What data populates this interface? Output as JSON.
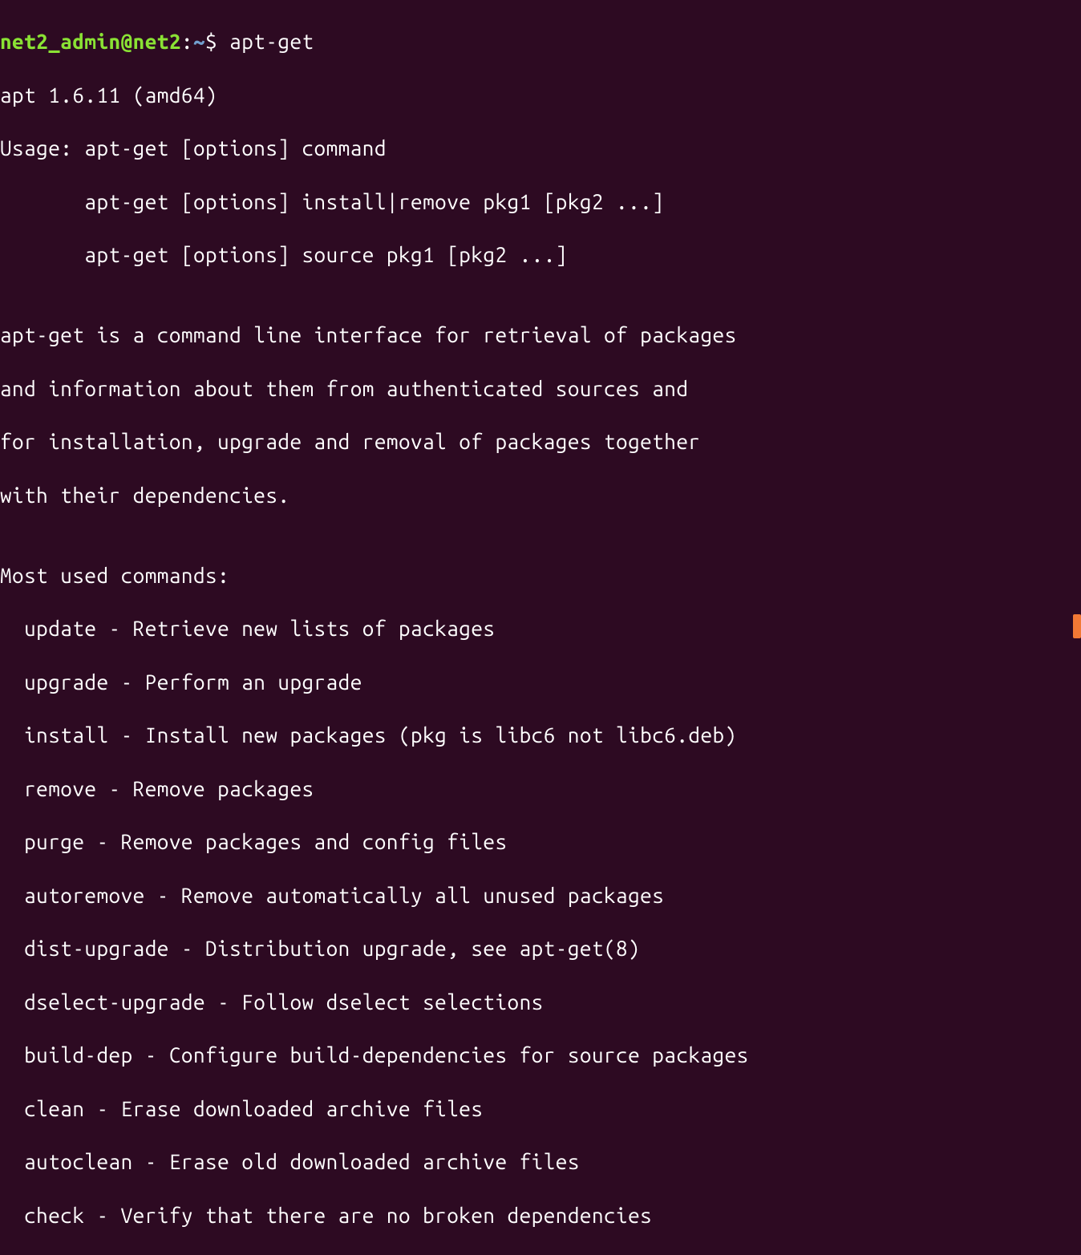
{
  "prompt": {
    "user_host": "net2_admin@net2",
    "colon": ":",
    "path": "~",
    "dollar": "$ ",
    "command": "apt-get"
  },
  "output": {
    "version": "apt 1.6.11 (amd64)",
    "usage_header": "Usage: apt-get [options] command",
    "usage_line2": "       apt-get [options] install|remove pkg1 [pkg2 ...]",
    "usage_line3": "       apt-get [options] source pkg1 [pkg2 ...]",
    "blank1": "",
    "desc_line1": "apt-get is a command line interface for retrieval of packages",
    "desc_line2": "and information about them from authenticated sources and",
    "desc_line3": "for installation, upgrade and removal of packages together",
    "desc_line4": "with their dependencies.",
    "blank2": "",
    "commands_header": "Most used commands:",
    "commands": [
      "  update - Retrieve new lists of packages",
      "  upgrade - Perform an upgrade",
      "  install - Install new packages (pkg is libc6 not libc6.deb)",
      "  remove - Remove packages",
      "  purge - Remove packages and config files",
      "  autoremove - Remove automatically all unused packages",
      "  dist-upgrade - Distribution upgrade, see apt-get(8)",
      "  dselect-upgrade - Follow dselect selections",
      "  build-dep - Configure build-dependencies for source packages",
      "  clean - Erase downloaded archive files",
      "  autoclean - Erase old downloaded archive files",
      "  check - Verify that there are no broken dependencies"
    ]
  }
}
